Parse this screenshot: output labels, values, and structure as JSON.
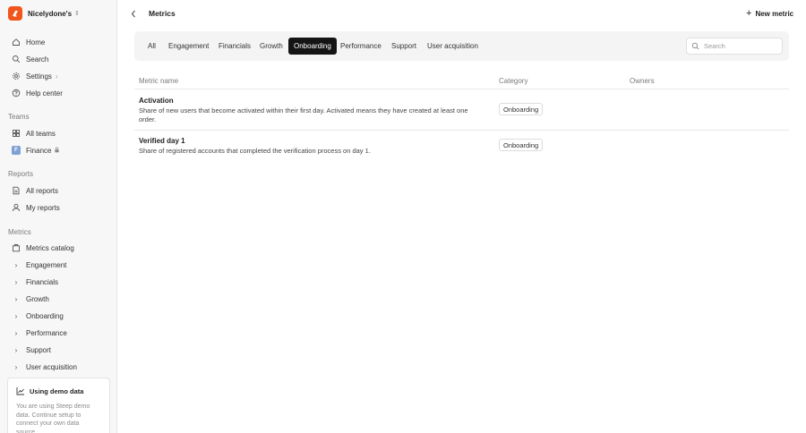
{
  "workspace": {
    "name": "Nicelydone's"
  },
  "sidebar": {
    "main": [
      {
        "label": "Home"
      },
      {
        "label": "Search"
      },
      {
        "label": "Settings"
      },
      {
        "label": "Help center"
      }
    ],
    "teams_label": "Teams",
    "teams": [
      {
        "label": "All teams"
      },
      {
        "label": "Finance",
        "avatar": "F"
      }
    ],
    "reports_label": "Reports",
    "reports": [
      {
        "label": "All reports"
      },
      {
        "label": "My reports"
      }
    ],
    "metrics_label": "Metrics",
    "metrics_catalog": "Metrics catalog",
    "metric_groups": [
      {
        "label": "Engagement"
      },
      {
        "label": "Financials"
      },
      {
        "label": "Growth"
      },
      {
        "label": "Onboarding"
      },
      {
        "label": "Performance"
      },
      {
        "label": "Support"
      },
      {
        "label": "User acquisition"
      }
    ]
  },
  "demo": {
    "title": "Using demo data",
    "text": "You are using Steep demo data. Continue setup to connect your own data source."
  },
  "header": {
    "title": "Metrics",
    "new_metric": "New metric"
  },
  "tabs": [
    {
      "label": "All"
    },
    {
      "label": "Engagement"
    },
    {
      "label": "Financials"
    },
    {
      "label": "Growth"
    },
    {
      "label": "Onboarding",
      "active": true
    },
    {
      "label": "Performance"
    },
    {
      "label": "Support"
    },
    {
      "label": "User acquisition"
    }
  ],
  "search": {
    "placeholder": "Search",
    "value": ""
  },
  "table": {
    "columns": [
      "Metric name",
      "Category",
      "Owners"
    ],
    "rows": [
      {
        "name": "Activation",
        "description": "Share of new users that become activated within their first day. Activated means they have created at least one order.",
        "category": "Onboarding"
      },
      {
        "name": "Verified day 1",
        "description": "Share of registered accounts that completed the verification process on day 1.",
        "category": "Onboarding"
      }
    ]
  },
  "colors": {
    "brand": "#f1551c",
    "active_tab": "#141414",
    "sidebar_bg": "#f7f7f7"
  }
}
